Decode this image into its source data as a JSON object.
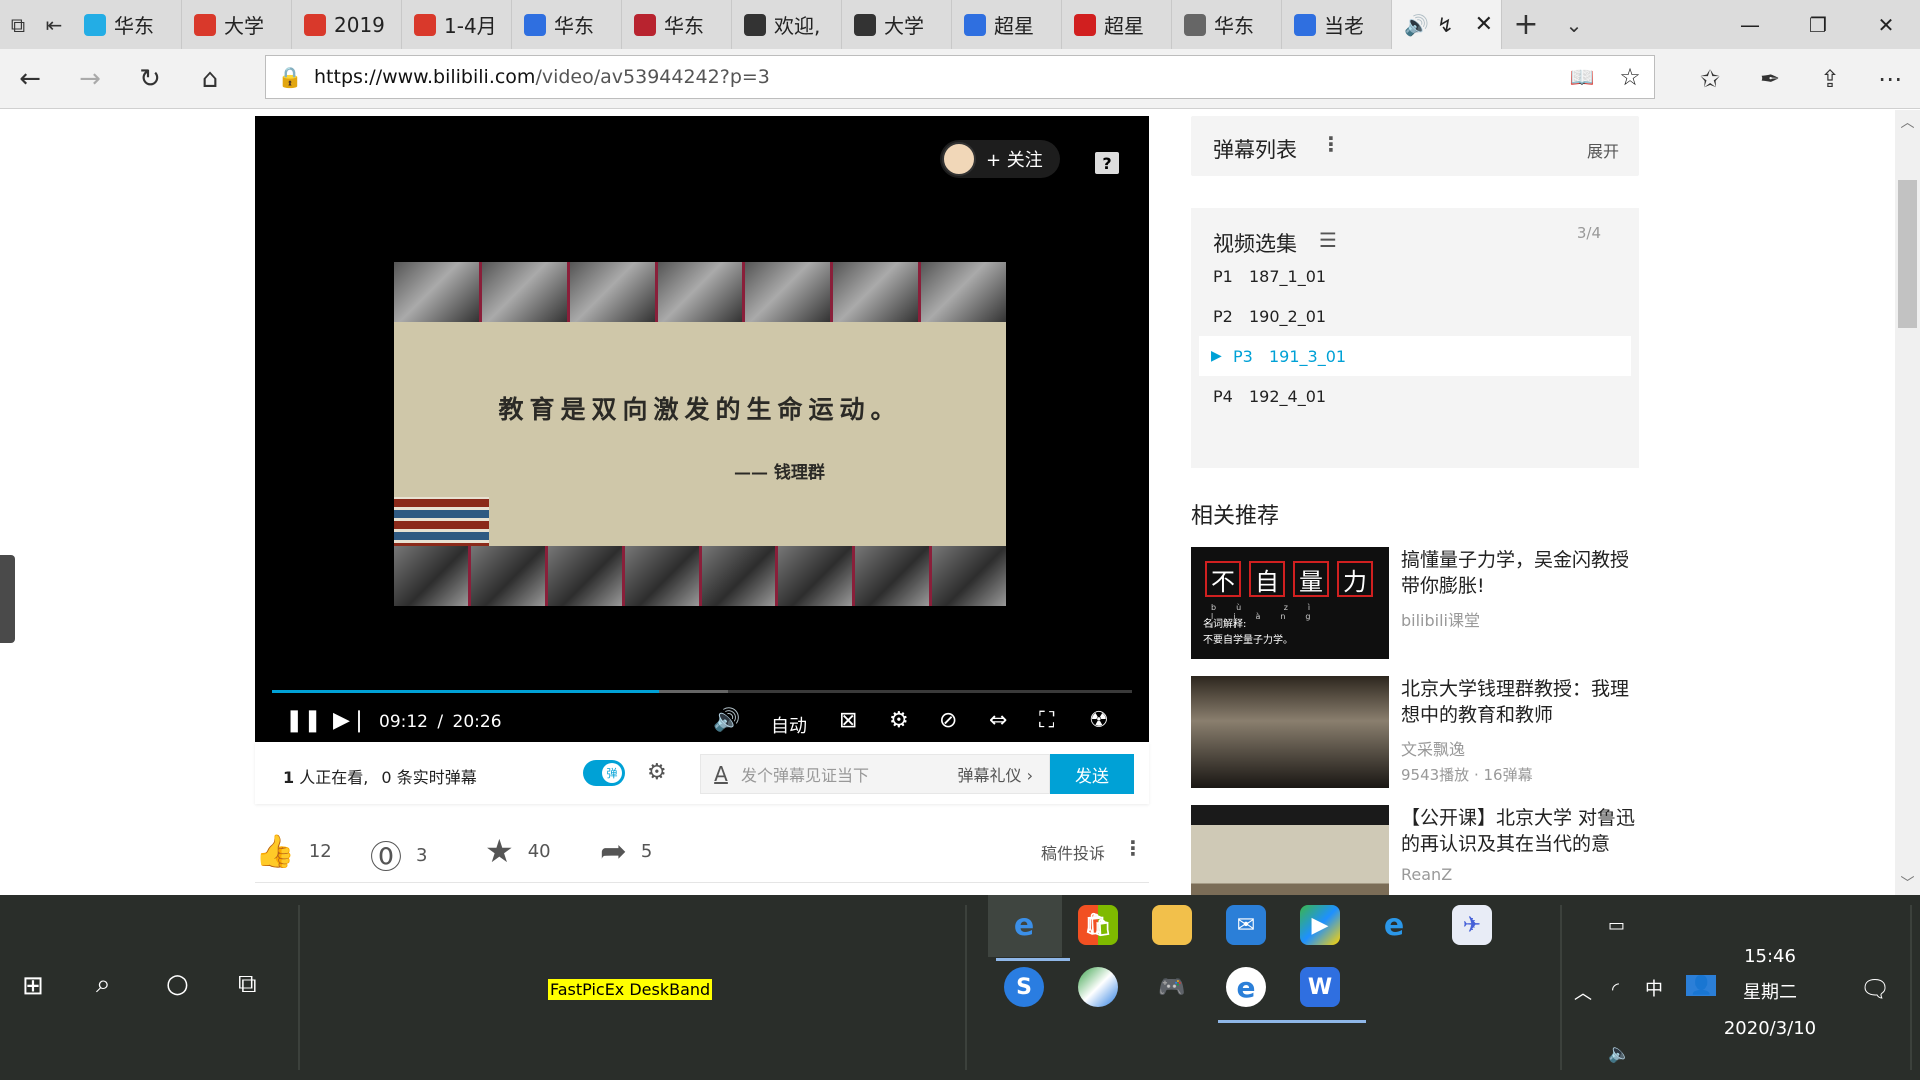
{
  "browser": {
    "tabs": [
      {
        "label": "华东",
        "icon": "bilibili-tv-icon",
        "color": "#23ade5"
      },
      {
        "label": "大学",
        "icon": "pdf-icon",
        "color": "#d9392b"
      },
      {
        "label": "2019",
        "icon": "pdf-icon",
        "color": "#d9392b"
      },
      {
        "label": "1-4月",
        "icon": "pdf-icon",
        "color": "#d9392b"
      },
      {
        "label": "华东",
        "icon": "paw-icon",
        "color": "#2f6fe0"
      },
      {
        "label": "华东",
        "icon": "university-seal-icon",
        "color": "#b8232f"
      },
      {
        "label": "欢迎,",
        "icon": "blackboard-icon",
        "color": "#333333"
      },
      {
        "label": "大学",
        "icon": "blackboard-icon",
        "color": "#333333"
      },
      {
        "label": "超星",
        "icon": "paw-icon",
        "color": "#2f6fe0"
      },
      {
        "label": "超星",
        "icon": "chaoxing-icon",
        "color": "#d11f1f"
      },
      {
        "label": "华东",
        "icon": "window-icon",
        "color": "#666666"
      },
      {
        "label": "当老",
        "icon": "paw-icon",
        "color": "#2f6fe0"
      }
    ],
    "active_tab": {
      "label": "↯"
    },
    "url_host": "https://www.bilibili.com",
    "url_path": "/video/av53944242?p=3"
  },
  "player": {
    "follow_label": "+ 关注",
    "quote": "教育是双向激发的生命运动。",
    "author": "—— 钱理群",
    "current_time": "09:12",
    "separator": "/",
    "duration": "20:26",
    "progress_fraction": 0.45,
    "quality_label": "自动"
  },
  "danmaku_bar": {
    "viewers": "1",
    "watching_text": "人正在看,",
    "live_count": "0",
    "live_text": "条实时弹幕",
    "toggle_label": "弹",
    "placeholder": "发个弹幕见证当下",
    "etiquette": "弹幕礼仪 ›",
    "send": "发送"
  },
  "actions": {
    "likes": "12",
    "coins": "3",
    "favorites": "40",
    "shares": "5",
    "report": "稿件投诉"
  },
  "sidebar": {
    "danmaku_list": "弹幕列表",
    "expand": "展开",
    "episodes_title": "视频选集",
    "episode_count": "3/4",
    "episodes": [
      {
        "p": "P1",
        "name": "187_1_01"
      },
      {
        "p": "P2",
        "name": "190_2_01"
      },
      {
        "p": "P3",
        "name": "191_3_01"
      },
      {
        "p": "P4",
        "name": "192_4_01"
      }
    ],
    "recommend_title": "相关推荐",
    "recommendations": [
      {
        "title": "搞懂量子力学，吴金闪教授带你膨胀!",
        "uploader": "bilibili课堂",
        "stats": ""
      },
      {
        "title": "北京大学钱理群教授：我理想中的教育和教师",
        "uploader": "文采飘逸",
        "stats": "9543播放 · 16弹幕"
      },
      {
        "title": "【公开课】北京大学 对鲁迅的再认识及其在当代的意",
        "uploader": "ReanZ",
        "stats": ""
      }
    ],
    "thumb1": {
      "chars": [
        "不",
        "自",
        "量",
        "力"
      ],
      "pinyin": "bù zì liàng lì",
      "caption1": "名词解释:",
      "caption2": "不要自学量子力学。"
    }
  },
  "taskbar": {
    "deskband": "FastPicEx DeskBand",
    "ime": "中",
    "time": "15:46",
    "weekday": "星期二",
    "date": "2020/3/10"
  }
}
